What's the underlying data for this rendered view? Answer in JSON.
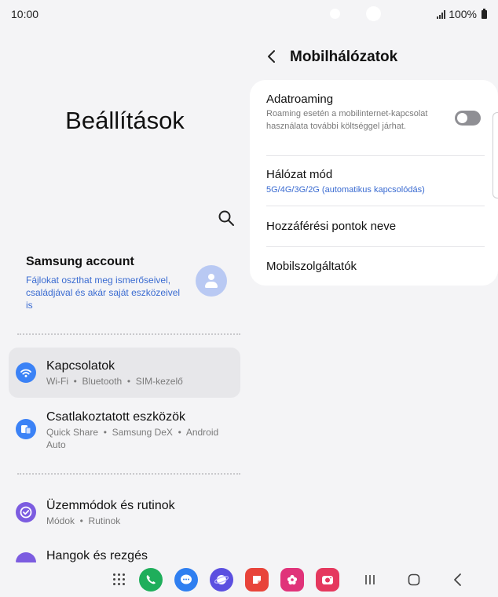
{
  "status": {
    "time": "10:00",
    "battery": "100%"
  },
  "left": {
    "title": "Beállítások",
    "account": {
      "title": "Samsung account",
      "description": "Fájlokat oszthat meg ismerőseivel, családjával és akár saját eszközeivel is"
    },
    "items": [
      {
        "label": "Kapcsolatok",
        "sub": "Wi-Fi  •  Bluetooth  •  SIM-kezelő",
        "icon": "wifi-icon",
        "color": "#3b82f6",
        "selected": true
      },
      {
        "label": "Csatlakoztatott eszközök",
        "sub": "Quick Share  •  Samsung DeX  •  Android Auto",
        "icon": "connected-devices-icon",
        "color": "#3b82f6",
        "selected": false
      },
      {
        "label": "Üzemmódok és rutinok",
        "sub": "Módok  •  Rutinok",
        "icon": "modes-icon",
        "color": "#7c5ce0",
        "selected": false
      },
      {
        "label": "Hangok és rezgés",
        "sub": "",
        "icon": "sound-icon",
        "color": "#7c5ce0",
        "selected": false
      }
    ]
  },
  "right": {
    "title": "Mobilhálózatok",
    "rows": [
      {
        "title": "Adatroaming",
        "sub": "Roaming esetén a mobilinternet-kapcsolat használata további költséggel járhat.",
        "toggle": false
      },
      {
        "title": "Hálózat mód",
        "sub": "5G/4G/3G/2G (automatikus kapcsolódás)"
      },
      {
        "title": "Hozzáférési pontok neve"
      },
      {
        "title": "Mobilszolgáltatók"
      }
    ]
  },
  "taskbar": {
    "apps": [
      {
        "name": "phone-app-icon",
        "color": "#1fae5b"
      },
      {
        "name": "messages-app-icon",
        "color": "#2f7ff0"
      },
      {
        "name": "internet-app-icon",
        "color": "#5b4fe0"
      },
      {
        "name": "notes-app-icon",
        "color": "#e8443a"
      },
      {
        "name": "gallery-app-icon",
        "color": "#e0337a"
      },
      {
        "name": "camera-app-icon",
        "color": "#e5385e"
      }
    ]
  },
  "colors": {
    "accent": "#3a6bd1",
    "background": "#f4f4f6"
  }
}
